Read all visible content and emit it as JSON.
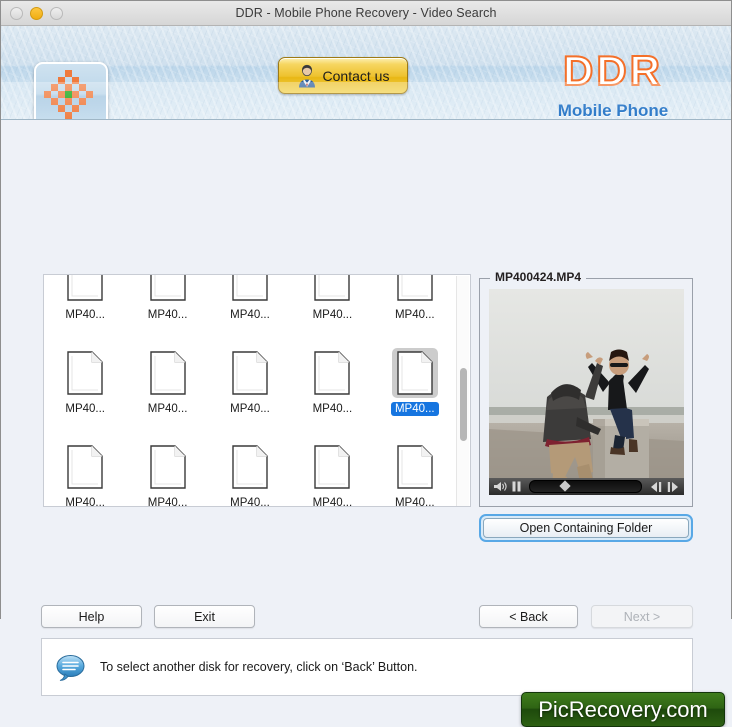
{
  "window": {
    "title": "DDR - Mobile Phone Recovery - Video Search",
    "traffic_lights": [
      "close",
      "minimize",
      "zoom"
    ]
  },
  "banner": {
    "app_icon_name": "ddr-app-icon",
    "contact_button": "Contact us",
    "brand_title": "DDR",
    "brand_subtitle": "Mobile Phone",
    "brand_title_color": "#f4702a",
    "brand_subtitle_color": "#1c6fc4"
  },
  "filelist": {
    "truncated_label": "MP40...",
    "selected_index": 9,
    "items": [
      {
        "label": "MP40..."
      },
      {
        "label": "MP40..."
      },
      {
        "label": "MP40..."
      },
      {
        "label": "MP40..."
      },
      {
        "label": "MP40..."
      },
      {
        "label": "MP40..."
      },
      {
        "label": "MP40..."
      },
      {
        "label": "MP40..."
      },
      {
        "label": "MP40..."
      },
      {
        "label": "MP40..."
      },
      {
        "label": "MP40..."
      },
      {
        "label": "MP40..."
      },
      {
        "label": "MP40..."
      },
      {
        "label": "MP40..."
      },
      {
        "label": "MP40..."
      },
      {
        "label": "MP40..."
      },
      {
        "label": "MP40..."
      },
      {
        "label": "MP40..."
      },
      {
        "label": "MP40..."
      },
      {
        "label": "MP40..."
      }
    ],
    "selection_color": "#1675e0"
  },
  "preview": {
    "filename": "MP400424.MP4",
    "controls": {
      "volume_icon": "speaker-icon",
      "pause_icon": "pause-icon",
      "step_back_icon": "step-backward-icon",
      "step_forward_icon": "step-forward-icon",
      "scrubber_position_percent": 28
    }
  },
  "actions": {
    "open_folder": "Open Containing Folder",
    "help": "Help",
    "exit": "Exit",
    "back": "< Back",
    "next": "Next >",
    "next_disabled": true,
    "focus_ring_color": "#58a8e6"
  },
  "status": {
    "icon": "speech-bubble-icon",
    "message": "To select another disk for recovery, click on ‘Back’ Button."
  },
  "watermark": {
    "text": "PicRecovery.com",
    "color": "#2f6414"
  }
}
